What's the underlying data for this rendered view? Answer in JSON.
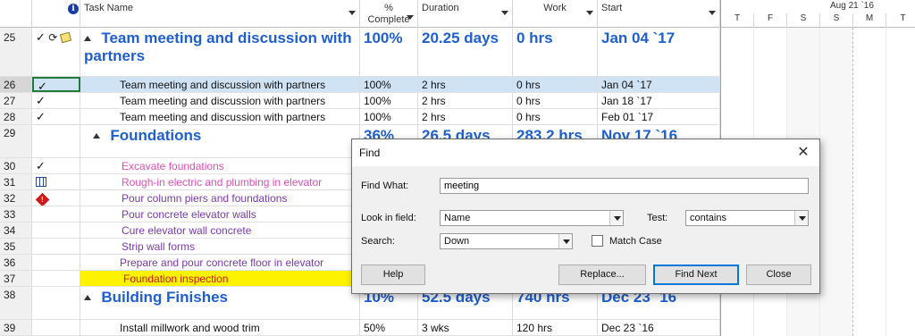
{
  "columns": {
    "id": "",
    "task_name": "Task Name",
    "pct_line1": "%",
    "pct_line2": "Complete",
    "duration": "Duration",
    "work": "Work",
    "start": "Start"
  },
  "gantt": {
    "week_label": "Aug 21 `16",
    "days": [
      "T",
      "F",
      "S",
      "S",
      "M",
      "T"
    ]
  },
  "rows": [
    {
      "id": "25",
      "indicators": "✓",
      "name": "Team meeting and discussion with partners",
      "pct": "100%",
      "duration": "20.25 days",
      "work": "0 hrs",
      "start": "Jan 04 `17"
    },
    {
      "id": "26",
      "indicators": "✓",
      "name": "Team meeting and discussion with partners",
      "pct": "100%",
      "duration": "2 hrs",
      "work": "0 hrs",
      "start": "Jan 04 `17"
    },
    {
      "id": "27",
      "indicators": "✓",
      "name": "Team meeting and discussion with partners",
      "pct": "100%",
      "duration": "2 hrs",
      "work": "0 hrs",
      "start": "Jan 18 `17"
    },
    {
      "id": "28",
      "indicators": "✓",
      "name": "Team meeting and discussion with partners",
      "pct": "100%",
      "duration": "2 hrs",
      "work": "0 hrs",
      "start": "Feb 01 `17"
    },
    {
      "id": "29",
      "indicators": "",
      "name": "Foundations",
      "pct": "36%",
      "duration": "26.5 days",
      "work": "283.2 hrs",
      "start": "Nov 17 `16"
    },
    {
      "id": "30",
      "indicators": "✓",
      "name": "Excavate foundations"
    },
    {
      "id": "31",
      "indicators": "",
      "name": "Rough-in electric and plumbing in elevator"
    },
    {
      "id": "32",
      "indicators": "",
      "name": "Pour column piers and foundations"
    },
    {
      "id": "33",
      "indicators": "",
      "name": "Pour concrete elevator walls"
    },
    {
      "id": "34",
      "indicators": "",
      "name": "Cure elevator wall concrete"
    },
    {
      "id": "35",
      "indicators": "",
      "name": "Strip wall forms"
    },
    {
      "id": "36",
      "indicators": "",
      "name": "Prepare and pour concrete floor in elevator"
    },
    {
      "id": "37",
      "indicators": "",
      "name": "Foundation inspection"
    },
    {
      "id": "38",
      "indicators": "",
      "name": "Building Finishes",
      "pct": "10%",
      "duration": "52.5 days",
      "work": "740 hrs",
      "start": "Dec 23 `16"
    },
    {
      "id": "39",
      "indicators": "",
      "name": "Install millwork and wood trim",
      "pct": "50%",
      "duration": "3 wks",
      "work": "120 hrs",
      "start": "Dec 23 `16"
    }
  ],
  "find_dialog": {
    "title": "Find",
    "close": "✕",
    "find_what_label": "Find What:",
    "find_what_value": "meeting",
    "look_in_label": "Look in field:",
    "look_in_value": "Name",
    "test_label": "Test:",
    "test_value": "contains",
    "search_label": "Search:",
    "search_value": "Down",
    "match_case_label": "Match Case",
    "match_case_checked": false,
    "help_button": "Help",
    "replace_button": "Replace...",
    "find_next_button": "Find Next",
    "close_button": "Close"
  },
  "colors": {
    "summary_text": "#1f5fd1",
    "critical_task": "#e04fb6",
    "task_purple": "#7a3ab0",
    "inspection_text": "#d01818",
    "highlight": "#fdf200",
    "selected_row": "#cfe3f5"
  }
}
